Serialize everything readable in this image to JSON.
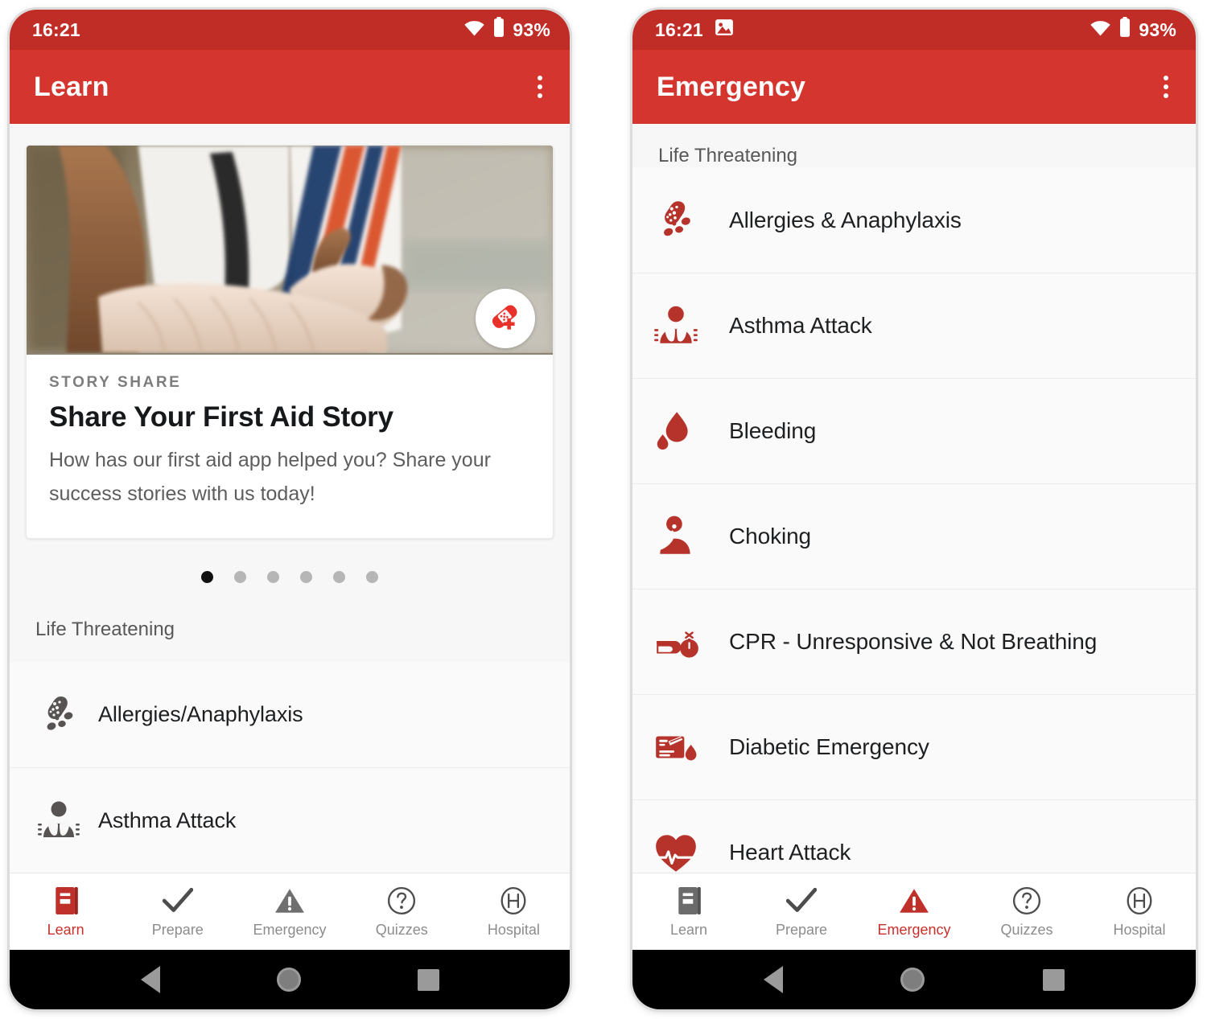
{
  "brand": {
    "primary": "#d4362f",
    "status_bar": "#bf2d26",
    "accent_text": "#c9302c",
    "icon_red": "#b5332b",
    "icon_grey": "#575352"
  },
  "phones": [
    {
      "id": "learn-screen",
      "status": {
        "clock": "16:21",
        "battery_pct": "93%",
        "wifi_icon": "wifi-icon",
        "battery_icon": "battery-icon",
        "screenshot_icon": null
      },
      "appbar": {
        "title": "Learn",
        "overflow_icon": "overflow-menu-icon"
      },
      "card": {
        "badge_icon": "bandage-plus-icon",
        "eyebrow": "STORY SHARE",
        "title": "Share Your First Aid Story",
        "description": "How has our first aid app helped you? Share your success stories with us today!",
        "photo_alt": "bandaged-arm-photo"
      },
      "carousel": {
        "total": 6,
        "active_index": 0
      },
      "section_label": "Life Threatening",
      "items": [
        {
          "icon": "peanut-allergy-icon",
          "label": "Allergies/Anaphylaxis",
          "color": "grey"
        },
        {
          "icon": "asthma-lungs-icon",
          "label": "Asthma Attack",
          "color": "grey"
        }
      ],
      "tabs": [
        {
          "icon": "book-icon",
          "label": "Learn",
          "active": true
        },
        {
          "icon": "check-icon",
          "label": "Prepare",
          "active": false
        },
        {
          "icon": "warning-icon",
          "label": "Emergency",
          "active": false
        },
        {
          "icon": "question-icon",
          "label": "Quizzes",
          "active": false
        },
        {
          "icon": "hospital-icon",
          "label": "Hospital",
          "active": false
        }
      ]
    },
    {
      "id": "emergency-screen",
      "status": {
        "clock": "16:21",
        "battery_pct": "93%",
        "wifi_icon": "wifi-icon",
        "battery_icon": "battery-icon",
        "screenshot_icon": "screenshot-icon"
      },
      "appbar": {
        "title": "Emergency",
        "overflow_icon": "overflow-menu-icon"
      },
      "section_label": "Life Threatening",
      "items": [
        {
          "icon": "peanut-allergy-icon",
          "label": "Allergies & Anaphylaxis",
          "color": "red"
        },
        {
          "icon": "asthma-lungs-icon",
          "label": "Asthma Attack",
          "color": "red"
        },
        {
          "icon": "blood-drop-icon",
          "label": "Bleeding",
          "color": "red"
        },
        {
          "icon": "choking-person-icon",
          "label": "Choking",
          "color": "red"
        },
        {
          "icon": "cpr-icon",
          "label": "CPR - Unresponsive & Not Breathing",
          "color": "red"
        },
        {
          "icon": "glucose-test-icon",
          "label": "Diabetic Emergency",
          "color": "red"
        },
        {
          "icon": "heart-ecg-icon",
          "label": "Heart Attack",
          "color": "red"
        }
      ],
      "tabs": [
        {
          "icon": "book-icon",
          "label": "Learn",
          "active": false
        },
        {
          "icon": "check-icon",
          "label": "Prepare",
          "active": false
        },
        {
          "icon": "warning-icon",
          "label": "Emergency",
          "active": true
        },
        {
          "icon": "question-icon",
          "label": "Quizzes",
          "active": false
        },
        {
          "icon": "hospital-icon",
          "label": "Hospital",
          "active": false
        }
      ]
    }
  ],
  "navbar": {
    "back": "back-triangle-icon",
    "home": "home-circle-icon",
    "recents": "recents-square-icon"
  }
}
